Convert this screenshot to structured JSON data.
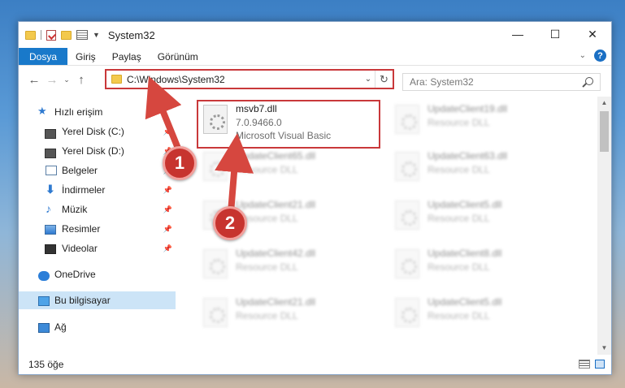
{
  "window": {
    "title": "System32",
    "controls": {
      "minimize": "—",
      "maximize": "☐",
      "close": "✕"
    }
  },
  "quick_access_toolbar": {
    "icons": [
      "folder-icon",
      "properties-check-icon",
      "new-folder-icon",
      "properties-icon",
      "customize-dropdown-icon"
    ]
  },
  "ribbon": {
    "tabs": [
      "Dosya",
      "Giriş",
      "Paylaş",
      "Görünüm"
    ],
    "file_tab_color": "#1979ca"
  },
  "navigation": {
    "back": "←",
    "forward": "→",
    "recent": "⌄",
    "up": "↑",
    "address": "C:\\Windows\\System32",
    "refresh": "↻",
    "search_placeholder": "Ara: System32"
  },
  "sidebar": {
    "items": [
      {
        "label": "Hızlı erişim",
        "icon": "star-icon",
        "pinned": false
      },
      {
        "label": "Yerel Disk (C:)",
        "icon": "drive-icon",
        "pinned": true
      },
      {
        "label": "Yerel Disk (D:)",
        "icon": "drive-icon",
        "pinned": true
      },
      {
        "label": "Belgeler",
        "icon": "documents-icon",
        "pinned": true
      },
      {
        "label": "İndirmeler",
        "icon": "downloads-icon",
        "pinned": true
      },
      {
        "label": "Müzik",
        "icon": "music-icon",
        "pinned": true
      },
      {
        "label": "Resimler",
        "icon": "pictures-icon",
        "pinned": true
      },
      {
        "label": "Videolar",
        "icon": "videos-icon",
        "pinned": true
      },
      {
        "label": "OneDrive",
        "icon": "onedrive-icon",
        "pinned": false
      },
      {
        "label": "Bu bilgisayar",
        "icon": "this-pc-icon",
        "pinned": false,
        "selected": true
      },
      {
        "label": "Ağ",
        "icon": "network-icon",
        "pinned": false
      }
    ]
  },
  "files": [
    {
      "name": "msvb7.dll",
      "line2": "7.0.9466.0",
      "line3": "Microsoft Visual Basic",
      "highlighted": true
    },
    {
      "name": "UpdateClient19.dll",
      "line2": "Resource DLL"
    },
    {
      "name": "UpdateClient65.dll",
      "line2": "Resource DLL"
    },
    {
      "name": "UpdateClient63.dll",
      "line2": "Resource DLL"
    },
    {
      "name": "UpdateClient21.dll",
      "line2": "Resource DLL"
    },
    {
      "name": "UpdateClient5.dll",
      "line2": "Resource DLL"
    },
    {
      "name": "UpdateClient42.dll",
      "line2": "Resource DLL"
    },
    {
      "name": "UpdateClient8.dll",
      "line2": "Resource DLL"
    },
    {
      "name": "UpdateClient21.dll",
      "line2": "Resource DLL"
    },
    {
      "name": "UpdateClient5.dll",
      "line2": "Resource DLL"
    }
  ],
  "status": {
    "item_count": "135 öğe"
  },
  "annotations": {
    "badge1": "1",
    "badge2": "2",
    "color": "#c9383a"
  }
}
